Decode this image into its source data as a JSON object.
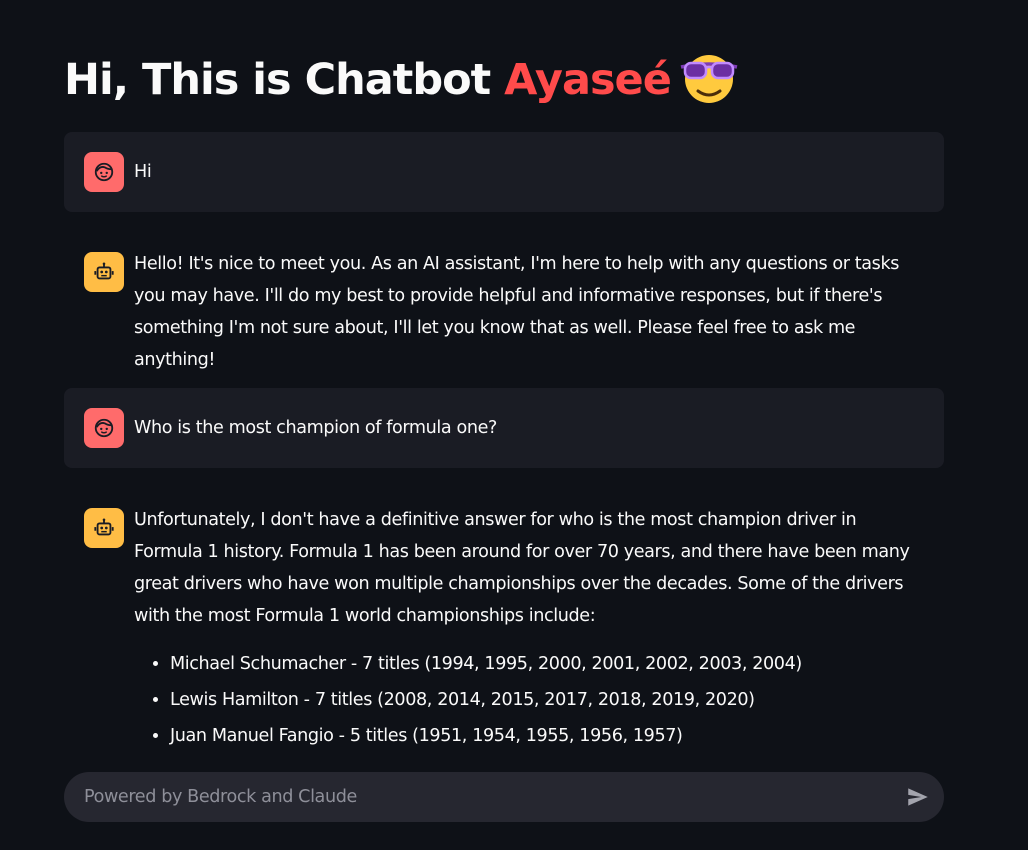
{
  "header": {
    "title_prefix": "Hi, This is Chatbot ",
    "title_name": "Ayaseé",
    "title_icon": "smiling-face-with-sunglasses-icon",
    "accent_color": "#ff4b4b"
  },
  "messages": [
    {
      "role": "user",
      "avatar_icon": "user-face-icon",
      "text": "Hi"
    },
    {
      "role": "assistant",
      "avatar_icon": "robot-icon",
      "text": "Hello! It's nice to meet you. As an AI assistant, I'm here to help with any questions or tasks you may have. I'll do my best to provide helpful and informative responses, but if there's something I'm not sure about, I'll let you know that as well. Please feel free to ask me anything!"
    },
    {
      "role": "user",
      "avatar_icon": "user-face-icon",
      "text": "Who is the most champion of formula one?"
    },
    {
      "role": "assistant",
      "avatar_icon": "robot-icon",
      "text": "Unfortunately, I don't have a definitive answer for who is the most champion driver in Formula 1 history. Formula 1 has been around for over 70 years, and there have been many great drivers who have won multiple championships over the decades. Some of the drivers with the most Formula 1 world championships include:",
      "list": [
        "Michael Schumacher - 7 titles (1994, 1995, 2000, 2001, 2002, 2003, 2004)",
        "Lewis Hamilton - 7 titles (2008, 2014, 2015, 2017, 2018, 2019, 2020)",
        "Juan Manuel Fangio - 5 titles (1951, 1954, 1955, 1956, 1957)"
      ]
    }
  ],
  "chat_input": {
    "placeholder": "Powered by Bedrock and Claude",
    "value": "",
    "send_icon": "send-icon"
  },
  "colors": {
    "background": "#0e1117",
    "user_message_bg": "#1a1c24",
    "user_avatar": "#ff6b6b",
    "assistant_avatar": "#ffbd45",
    "input_bg": "#262730"
  }
}
